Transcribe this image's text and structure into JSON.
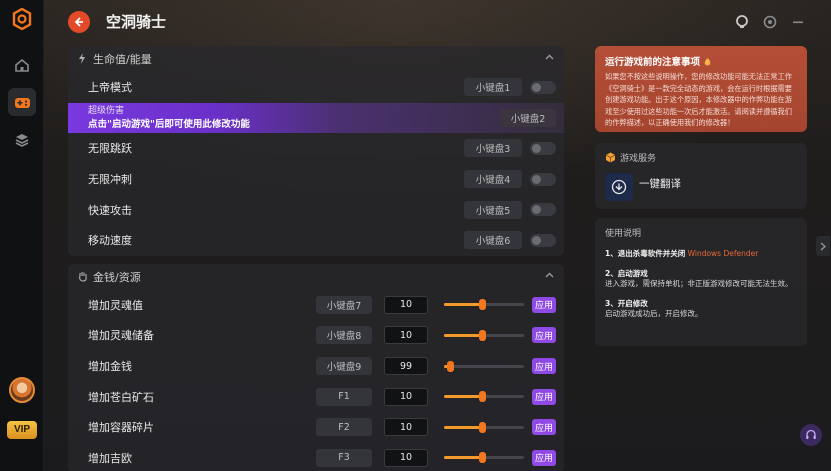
{
  "app": {
    "title": "空洞骑士",
    "vip_label": "VIP"
  },
  "colors": {
    "accent_purple": "#8f4ae6",
    "accent_orange": "#f3771e",
    "notice_bg": "#b54e37",
    "back_button": "#e24a2a"
  },
  "sections": {
    "health": {
      "title": "生命值/能量",
      "rows": [
        {
          "name": "上帝模式",
          "key": "小键盘1"
        },
        {
          "name_small": "超级伤害",
          "note": "点击\"启动游戏\"后即可使用此修改功能",
          "key": "小键盘2"
        },
        {
          "name": "无限跳跃",
          "key": "小键盘3"
        },
        {
          "name": "无限冲刺",
          "key": "小键盘4"
        },
        {
          "name": "快速攻击",
          "key": "小键盘5"
        },
        {
          "name": "移动速度",
          "key": "小键盘6"
        }
      ]
    },
    "money": {
      "title": "金钱/资源",
      "apply_label": "应用",
      "rows": [
        {
          "name": "增加灵魂值",
          "key": "小键盘7",
          "value": "10",
          "slider": 0.48
        },
        {
          "name": "增加灵魂储备",
          "key": "小键盘8",
          "value": "10",
          "slider": 0.48
        },
        {
          "name": "增加金钱",
          "key": "小键盘9",
          "value": "99",
          "slider": 0.08
        },
        {
          "name": "增加苍白矿石",
          "key": "F1",
          "value": "10",
          "slider": 0.48
        },
        {
          "name": "增加容器碎片",
          "key": "F2",
          "value": "10",
          "slider": 0.48
        },
        {
          "name": "增加吉欧",
          "key": "F3",
          "value": "10",
          "slider": 0.48
        }
      ]
    }
  },
  "notice": {
    "title": "运行游戏前的注意事项",
    "body": "如果您不按这些说明操作，您的修改功能可能无法正常工作《空洞骑士》是一款完全动态的游戏，会在运行时根据需要创建游戏功能。出于这个原因，本修改器中的作弊功能在游戏至少使用过这些功能一次后才能激活。请阅读并遵循我们的作弊描述，以正确使用我们的修改器！"
  },
  "service": {
    "title": "游戏服务",
    "item_label": "一键翻译"
  },
  "instructions": {
    "title": "使用说明",
    "step1_title": "1、退出杀毒软件并关闭",
    "step1_highlight": "Windows Defender",
    "step2_title": "2、启动游戏",
    "step2_body": "进入游戏，需保持单机；非正版游戏修改可能无法生效。",
    "step3_title": "3、开启修改",
    "step3_body": "启动游戏成功后，开启修改。"
  },
  "icons": [
    "app-logo-icon",
    "home-icon",
    "gamepad-icon",
    "layers-icon",
    "back-arrow-icon",
    "bulb-icon",
    "settings-icon",
    "minimize-icon",
    "lightning-icon",
    "chevron-up-icon",
    "hand-icon",
    "fire-icon",
    "cube-icon",
    "translate-icon",
    "chevron-right-icon",
    "headset-icon"
  ]
}
